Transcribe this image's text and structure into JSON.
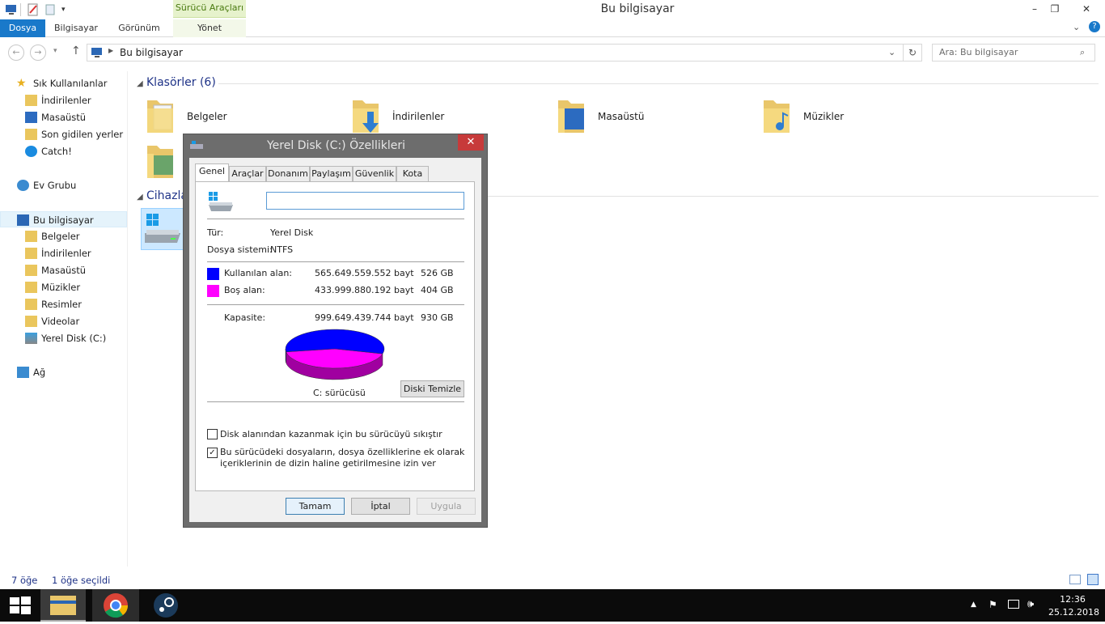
{
  "window": {
    "title": "Bu bilgisayar",
    "context_group": "Sürücü Araçları",
    "controls": [
      "–",
      "❐",
      "✕"
    ]
  },
  "ribbon": {
    "tabs": [
      "Dosya",
      "Bilgisayar",
      "Görünüm",
      "Yönet"
    ]
  },
  "address": {
    "path": "Bu bilgisayar",
    "search_placeholder": "Ara: Bu bilgisayar"
  },
  "nav": {
    "favorites_header": "Sık Kullanılanlar",
    "favorites": [
      "İndirilenler",
      "Masaüstü",
      "Son gidilen yerler",
      "Catch!"
    ],
    "homegroup": "Ev Grubu",
    "this_pc": "Bu bilgisayar",
    "this_pc_items": [
      "Belgeler",
      "İndirilenler",
      "Masaüstü",
      "Müzikler",
      "Resimler",
      "Videolar",
      "Yerel Disk (C:)"
    ],
    "network": "Ağ"
  },
  "content": {
    "folders_header": "Klasörler (6)",
    "folders": [
      "Belgeler",
      "İndirilenler",
      "Masaüstü",
      "Müzikler"
    ],
    "devices_header": "Cihazla"
  },
  "status": {
    "count": "7 öğe",
    "selected": "1 öğe seçildi"
  },
  "dialog": {
    "title": "Yerel Disk (C:) Özellikleri",
    "close": "✕",
    "tabs": [
      "Genel",
      "Araçlar",
      "Donanım",
      "Paylaşım",
      "Güvenlik",
      "Kota"
    ],
    "name_value": "",
    "type_label": "Tür:",
    "type_value": "Yerel Disk",
    "fs_label": "Dosya sistemi:",
    "fs_value": "NTFS",
    "used_label": "Kullanılan alan:",
    "used_bytes": "565.649.559.552 bayt",
    "used_gb": "526 GB",
    "free_label": "Boş alan:",
    "free_bytes": "433.999.880.192 bayt",
    "free_gb": "404 GB",
    "cap_label": "Kapasite:",
    "cap_bytes": "999.649.439.744 bayt",
    "cap_gb": "930 GB",
    "drive_label": "C: sürücüsü",
    "cleanup_button": "Diski Temizle",
    "compress_label": "Disk alanından kazanmak için bu sürücüyü sıkıştır",
    "compress_checked": false,
    "index_label_1": "Bu sürücüdeki dosyaların, dosya özelliklerine ek olarak",
    "index_label_2": "içeriklerinin de dizin haline getirilmesine izin ver",
    "index_checked": true,
    "ok": "Tamam",
    "cancel": "İptal",
    "apply": "Uygula",
    "used_color": "#0000ff",
    "free_color": "#ff00ff",
    "used_fraction": 0.566
  },
  "taskbar": {
    "time": "12:36",
    "date": "25.12.2018"
  }
}
